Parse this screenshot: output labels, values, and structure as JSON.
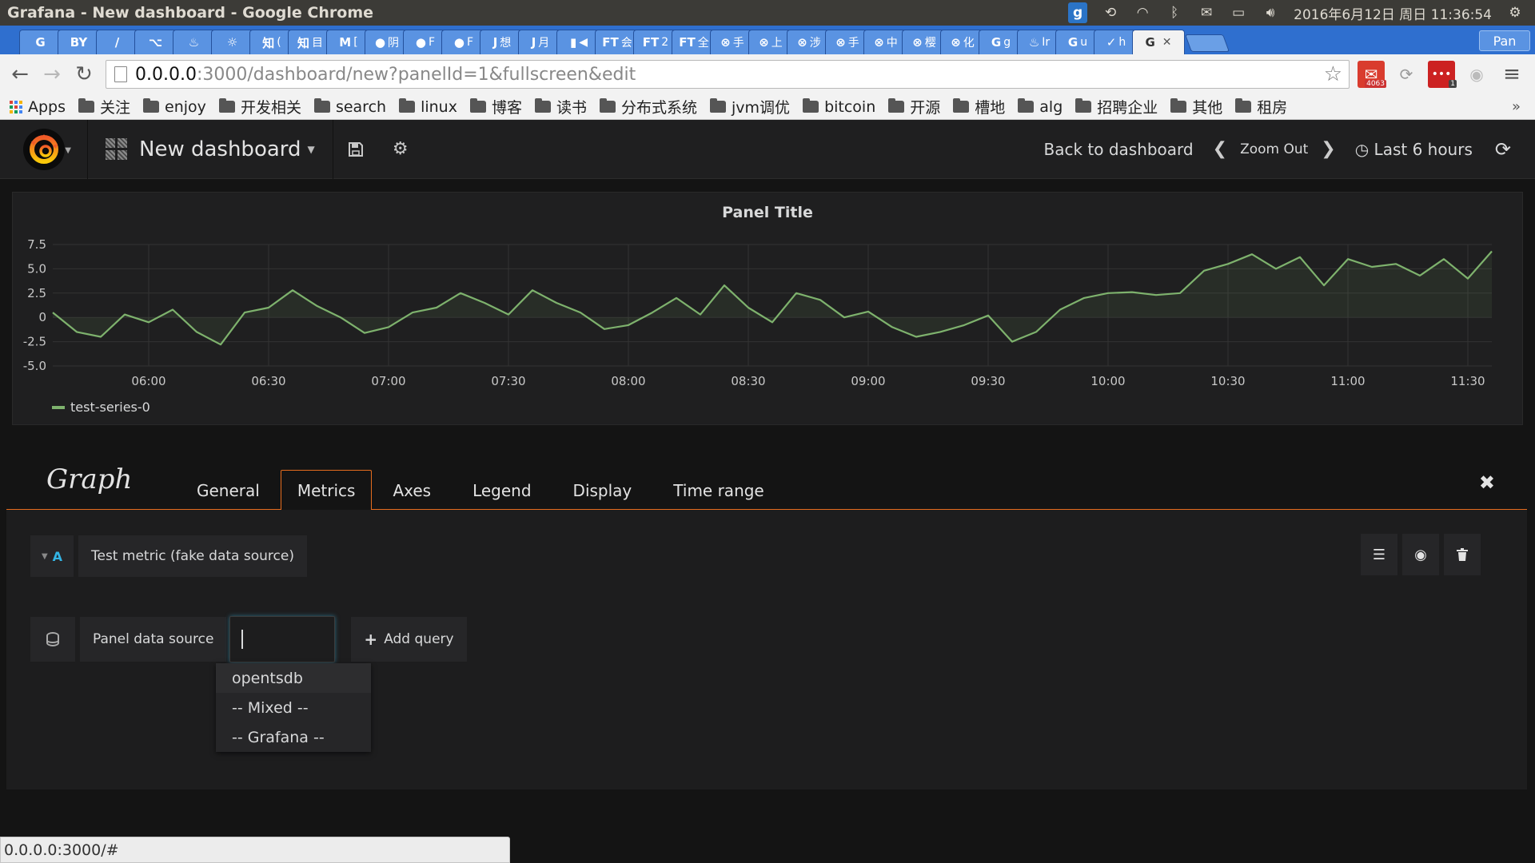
{
  "os": {
    "window_title": "Grafana - New dashboard - Google Chrome",
    "clock": "2016年6月12日 周日 11:36:54"
  },
  "chrome": {
    "tabs": [
      {
        "icon": "G",
        "label": ""
      },
      {
        "icon": "BY",
        "label": ""
      },
      {
        "icon": "/",
        "label": ""
      },
      {
        "icon": "⌥",
        "label": ""
      },
      {
        "icon": "♨",
        "label": ""
      },
      {
        "icon": "☼",
        "label": ""
      },
      {
        "icon": "知",
        "label": "("
      },
      {
        "icon": "知",
        "label": "目"
      },
      {
        "icon": "M",
        "label": "["
      },
      {
        "icon": "●",
        "label": "阴"
      },
      {
        "icon": "●",
        "label": "F"
      },
      {
        "icon": "●",
        "label": "F"
      },
      {
        "icon": "J",
        "label": "想"
      },
      {
        "icon": "J",
        "label": "月"
      },
      {
        "icon": "▮",
        "label": "◀"
      },
      {
        "icon": "FT",
        "label": "会"
      },
      {
        "icon": "FT",
        "label": "2"
      },
      {
        "icon": "FT",
        "label": "全"
      },
      {
        "icon": "⊗",
        "label": "手"
      },
      {
        "icon": "⊗",
        "label": "上"
      },
      {
        "icon": "⊗",
        "label": "涉"
      },
      {
        "icon": "⊗",
        "label": "手"
      },
      {
        "icon": "⊗",
        "label": "中"
      },
      {
        "icon": "⊗",
        "label": "樱"
      },
      {
        "icon": "⊗",
        "label": "化"
      },
      {
        "icon": "G",
        "label": "g"
      },
      {
        "icon": "♨",
        "label": "Ir"
      },
      {
        "icon": "G",
        "label": "u"
      },
      {
        "icon": "✓",
        "label": "h"
      }
    ],
    "active_tab": {
      "icon": "G",
      "close": "✕"
    },
    "profile_label": "Pan",
    "url_host": "0.0.0.0",
    "url_rest": ":3000/dashboard/new?panelId=1&fullscreen&edit",
    "mail_badge": "4063",
    "ext_badge": "1",
    "bookmarks": [
      {
        "label": "Apps",
        "type": "apps"
      },
      {
        "label": "关注",
        "type": "folder"
      },
      {
        "label": "enjoy",
        "type": "folder"
      },
      {
        "label": "开发相关",
        "type": "folder"
      },
      {
        "label": "search",
        "type": "folder"
      },
      {
        "label": "linux",
        "type": "folder"
      },
      {
        "label": "博客",
        "type": "folder"
      },
      {
        "label": "读书",
        "type": "folder"
      },
      {
        "label": "分布式系统",
        "type": "folder"
      },
      {
        "label": "jvm调优",
        "type": "folder"
      },
      {
        "label": "bitcoin",
        "type": "folder"
      },
      {
        "label": "开源",
        "type": "folder"
      },
      {
        "label": "槽地",
        "type": "folder"
      },
      {
        "label": "alg",
        "type": "folder"
      },
      {
        "label": "招聘企业",
        "type": "folder"
      },
      {
        "label": "其他",
        "type": "folder"
      },
      {
        "label": "租房",
        "type": "folder"
      }
    ],
    "bookmarks_more": "»",
    "status_url": "0.0.0.0:3000/#"
  },
  "grafana": {
    "dashboard_title": "New dashboard",
    "back_to_dashboard": "Back to dashboard",
    "zoom_out": "Zoom Out",
    "time_range": "Last 6 hours",
    "colors": {
      "series": "#7eb26d",
      "accent": "#e56c1e",
      "query_letter": "#33b5e5"
    }
  },
  "panel": {
    "title": "Panel Title"
  },
  "chart_data": {
    "type": "line",
    "x_label_ticks": [
      "06:00",
      "06:30",
      "07:00",
      "07:30",
      "08:00",
      "08:30",
      "09:00",
      "09:30",
      "10:00",
      "10:30",
      "11:00",
      "11:30"
    ],
    "y_ticks": [
      "7.5",
      "5.0",
      "2.5",
      "0",
      "-2.5",
      "-5.0"
    ],
    "ylim": [
      -5,
      7.5
    ],
    "xlim": [
      "05:36",
      "11:36"
    ],
    "grid": true,
    "legend_position": "bottom-left",
    "series": [
      {
        "name": "test-series-0",
        "color": "#7eb26d",
        "x": [
          "05:36",
          "05:42",
          "05:48",
          "05:54",
          "06:00",
          "06:06",
          "06:12",
          "06:18",
          "06:24",
          "06:30",
          "06:36",
          "06:42",
          "06:48",
          "06:54",
          "07:00",
          "07:06",
          "07:12",
          "07:18",
          "07:24",
          "07:30",
          "07:36",
          "07:42",
          "07:48",
          "07:54",
          "08:00",
          "08:06",
          "08:12",
          "08:18",
          "08:24",
          "08:30",
          "08:36",
          "08:42",
          "08:48",
          "08:54",
          "09:00",
          "09:06",
          "09:12",
          "09:18",
          "09:24",
          "09:30",
          "09:36",
          "09:42",
          "09:48",
          "09:54",
          "10:00",
          "10:06",
          "10:12",
          "10:18",
          "10:24",
          "10:30",
          "10:36",
          "10:42",
          "10:48",
          "10:54",
          "11:00",
          "11:06",
          "11:12",
          "11:18",
          "11:24",
          "11:30",
          "11:36"
        ],
        "y": [
          0.5,
          -1.5,
          -2.0,
          0.3,
          -0.5,
          0.8,
          -1.5,
          -2.8,
          0.5,
          1.0,
          2.8,
          1.2,
          0.0,
          -1.6,
          -1.0,
          0.5,
          1.0,
          2.5,
          1.5,
          0.3,
          2.8,
          1.5,
          0.5,
          -1.2,
          -0.8,
          0.5,
          2.0,
          0.3,
          3.3,
          1.0,
          -0.5,
          2.5,
          1.8,
          0.0,
          0.6,
          -1.0,
          -2.0,
          -1.5,
          -0.8,
          0.2,
          -2.5,
          -1.5,
          0.8,
          2.0,
          2.5,
          2.6,
          2.3,
          2.5,
          4.8,
          5.5,
          6.5,
          5.0,
          6.2,
          3.3,
          6.0,
          5.2,
          5.5,
          4.3,
          6.0,
          4.0,
          6.8
        ]
      }
    ]
  },
  "editor": {
    "title": "Graph",
    "tabs": [
      "General",
      "Metrics",
      "Axes",
      "Legend",
      "Display",
      "Time range"
    ],
    "active_tab_index": 1,
    "close": "✖",
    "query": {
      "letter": "A",
      "text": "Test metric (fake data source)"
    },
    "panel_data_source_label": "Panel data source",
    "data_source_value": "",
    "add_query": "Add query",
    "datasource_options": [
      "opentsdb",
      "-- Mixed --",
      "-- Grafana --"
    ]
  }
}
